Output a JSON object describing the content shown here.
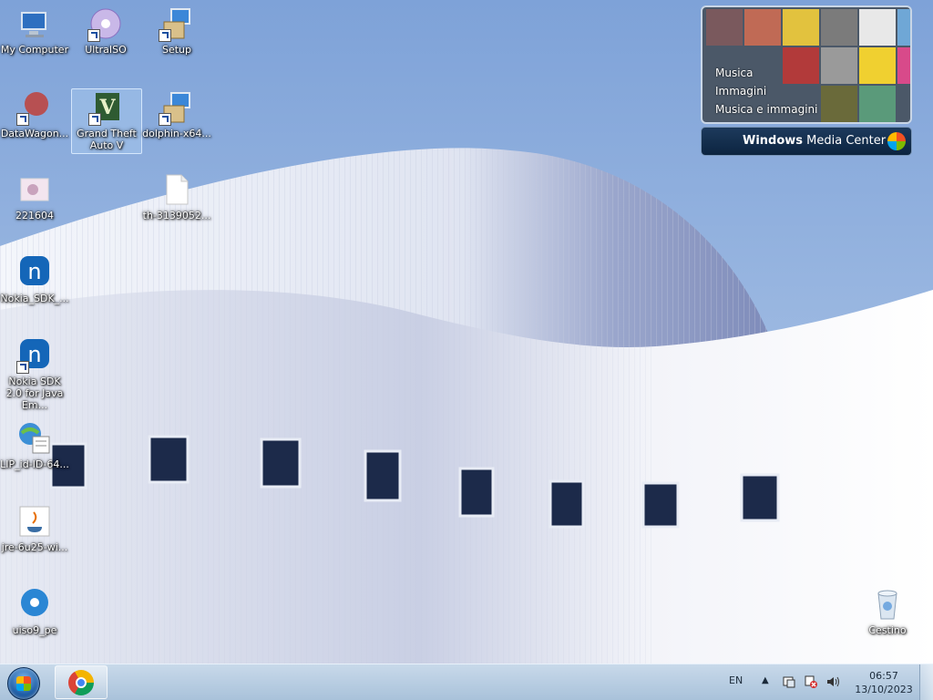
{
  "desktop": {
    "icons": [
      {
        "label": "My Computer"
      },
      {
        "label": "UltraISO"
      },
      {
        "label": "Setup"
      },
      {
        "label": "DataWagon..."
      },
      {
        "label": "Grand Theft Auto V"
      },
      {
        "label": "dolphin-x64..."
      },
      {
        "label": "221604"
      },
      {
        "label": "th-3139052..."
      },
      {
        "label": "Nokia_SDK_..."
      },
      {
        "label": "Nokia SDK 2.0 for Java Em..."
      },
      {
        "label": "LIP_id-ID-64..."
      },
      {
        "label": "jre-6u25-wi..."
      },
      {
        "label": "uiso9_pe"
      },
      {
        "label": "Cestino"
      }
    ]
  },
  "media_center": {
    "menu": [
      "Musica",
      "Immagini",
      "Musica e immagini"
    ],
    "title_bold": "Windows",
    "title_rest": " Media Center"
  },
  "taskbar": {
    "language": "EN",
    "time": "06:57",
    "date": "13/10/2023"
  }
}
